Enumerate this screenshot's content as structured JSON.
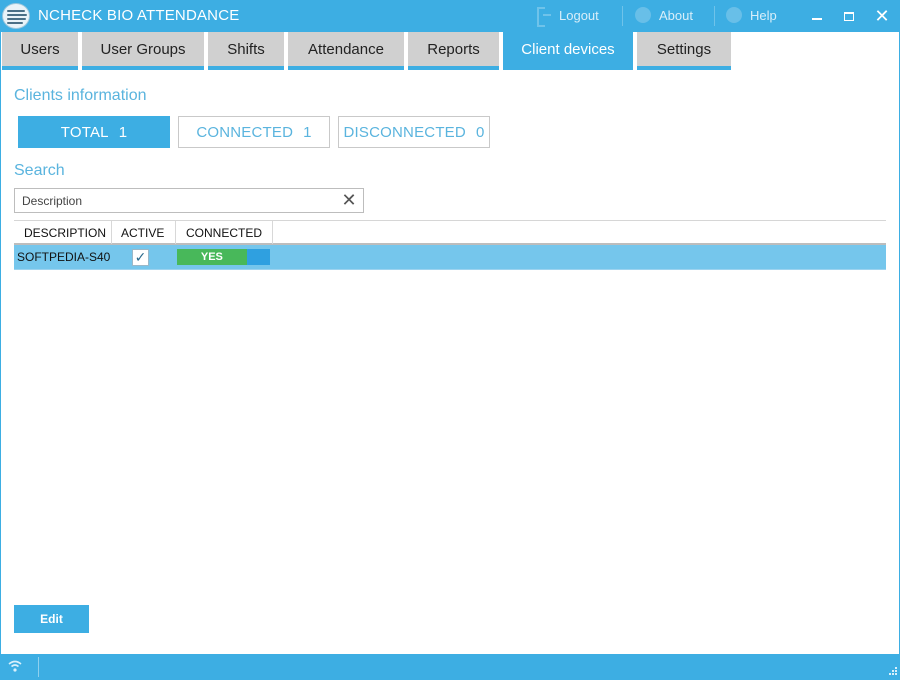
{
  "window": {
    "title": "NCHECK BIO ATTENDANCE",
    "logout_label": "Logout",
    "about_label": "About",
    "help_label": "Help",
    "accent_color": "#3daee3"
  },
  "tabs": [
    {
      "label": "Users"
    },
    {
      "label": "User Groups"
    },
    {
      "label": "Shifts"
    },
    {
      "label": "Attendance"
    },
    {
      "label": "Reports"
    },
    {
      "label": "Client devices",
      "active": true
    },
    {
      "label": "Settings"
    }
  ],
  "clients": {
    "section_title": "Clients information",
    "total": {
      "label": "TOTAL",
      "count": "1"
    },
    "connected": {
      "label": "CONNECTED",
      "count": "1"
    },
    "disconnected": {
      "label": "DISCONNECTED",
      "count": "0"
    }
  },
  "search": {
    "title": "Search",
    "placeholder": "Description",
    "value": ""
  },
  "grid": {
    "columns": [
      "DESCRIPTION",
      "ACTIVE",
      "CONNECTED"
    ],
    "rows": [
      {
        "description": "SOFTPEDIA-S40",
        "active": true,
        "connected": "YES",
        "connected_level_percent": 75
      }
    ]
  },
  "actions": {
    "edit_label": "Edit"
  },
  "icons": {
    "app_logo": "fingerprint-globe-icon",
    "logout": "logout-icon",
    "about": "info-icon",
    "help": "help-icon",
    "clear": "close-icon",
    "status": "wifi-icon"
  }
}
